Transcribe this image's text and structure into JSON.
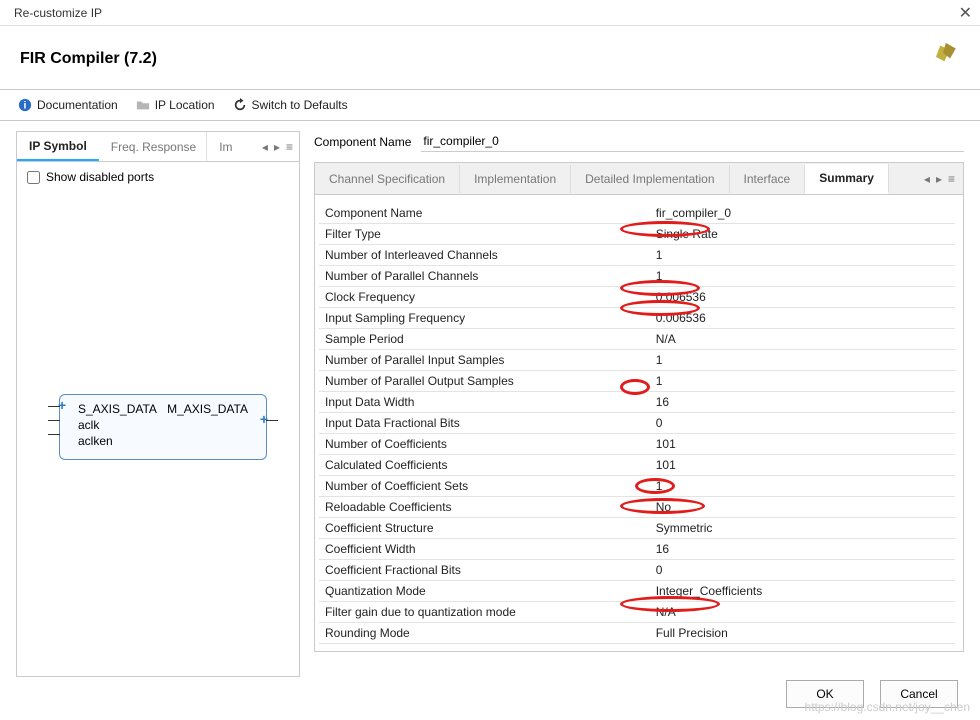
{
  "window": {
    "title": "Re-customize IP"
  },
  "header": {
    "title": "FIR Compiler (7.2)"
  },
  "toolbar": {
    "doc": "Documentation",
    "loc": "IP Location",
    "switch": "Switch to Defaults"
  },
  "left": {
    "tabs": {
      "symbol": "IP Symbol",
      "freq": "Freq. Response",
      "imp": "Im"
    },
    "show_disabled": "Show disabled ports",
    "ip": {
      "in1": "S_AXIS_DATA",
      "in2": "aclk",
      "in3": "aclken",
      "out1": "M_AXIS_DATA"
    }
  },
  "component": {
    "label": "Component Name",
    "value": "fir_compiler_0"
  },
  "rtabs": {
    "t0": "Channel Specification",
    "t1": "Implementation",
    "t2": "Detailed Implementation",
    "t3": "Interface",
    "t4": "Summary"
  },
  "summary": [
    {
      "k": "Component Name",
      "v": "fir_compiler_0"
    },
    {
      "k": "Filter Type",
      "v": "Single Rate"
    },
    {
      "k": "Number of Interleaved Channels",
      "v": "1"
    },
    {
      "k": "Number of Parallel Channels",
      "v": "1"
    },
    {
      "k": "Clock Frequency",
      "v": "0.006536"
    },
    {
      "k": "Input Sampling Frequency",
      "v": "0.006536"
    },
    {
      "k": "Sample Period",
      "v": "N/A"
    },
    {
      "k": "Number of Parallel Input Samples",
      "v": "1"
    },
    {
      "k": "Number of Parallel Output Samples",
      "v": "1"
    },
    {
      "k": "Input Data Width",
      "v": "16"
    },
    {
      "k": "Input Data Fractional Bits",
      "v": "0"
    },
    {
      "k": "Number of Coefficients",
      "v": "101"
    },
    {
      "k": "Calculated Coefficients",
      "v": "101"
    },
    {
      "k": "Number of Coefficient Sets",
      "v": "1"
    },
    {
      "k": "Reloadable Coefficients",
      "v": "No"
    },
    {
      "k": "Coefficient Structure",
      "v": "Symmetric"
    },
    {
      "k": "Coefficient Width",
      "v": "16"
    },
    {
      "k": "Coefficient Fractional Bits",
      "v": "0"
    },
    {
      "k": "Quantization Mode",
      "v": "Integer_Coefficients"
    },
    {
      "k": "Filter gain due to quantization mode",
      "v": "N/A"
    },
    {
      "k": "Rounding Mode",
      "v": "Full Precision"
    }
  ],
  "footer": {
    "ok": "OK",
    "cancel": "Cancel"
  },
  "watermark": "https://blog.csdn.net/joy__chen"
}
